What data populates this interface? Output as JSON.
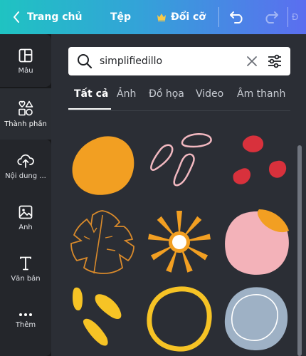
{
  "topbar": {
    "back_label": "Trang chủ",
    "file_label": "Tệp",
    "resize_label": "Đổi cỡ",
    "more_label": "Đ"
  },
  "sidebar": {
    "items": [
      {
        "label": "Mẫu",
        "icon": "layout-icon"
      },
      {
        "label": "Thành phần",
        "icon": "elements-icon"
      },
      {
        "label": "Nội dung ...",
        "icon": "upload-icon"
      },
      {
        "label": "Ảnh",
        "icon": "photo-icon"
      },
      {
        "label": "Văn bản",
        "icon": "text-icon"
      },
      {
        "label": "Thêm",
        "icon": "more-icon"
      }
    ],
    "active_index": 1
  },
  "search": {
    "value": "simplifiedillo"
  },
  "tabs": [
    {
      "label": "Tất cả",
      "active": true
    },
    {
      "label": "Ảnh",
      "active": false
    },
    {
      "label": "Đồ họa",
      "active": false
    },
    {
      "label": "Video",
      "active": false
    },
    {
      "label": "Âm thanh",
      "active": false
    }
  ],
  "graphics": [
    {
      "name": "orange-blob",
      "colors": [
        "#f29f22"
      ]
    },
    {
      "name": "pink-outline-squiggles",
      "colors": [
        "#f2b8c0"
      ]
    },
    {
      "name": "red-dots",
      "colors": [
        "#d8313c"
      ]
    },
    {
      "name": "monstera-leaf-outline",
      "colors": [
        "#d98a2b"
      ]
    },
    {
      "name": "orange-flower",
      "colors": [
        "#f29f22",
        "#ffffff"
      ]
    },
    {
      "name": "pink-blob-orange-corner",
      "colors": [
        "#f3b2b9",
        "#f29f22"
      ]
    },
    {
      "name": "yellow-dashes",
      "colors": [
        "#f6c325"
      ]
    },
    {
      "name": "yellow-ring",
      "colors": [
        "#f6c325"
      ]
    },
    {
      "name": "blue-grey-blob",
      "colors": [
        "#9eb1c5",
        "#ffffff"
      ]
    }
  ]
}
